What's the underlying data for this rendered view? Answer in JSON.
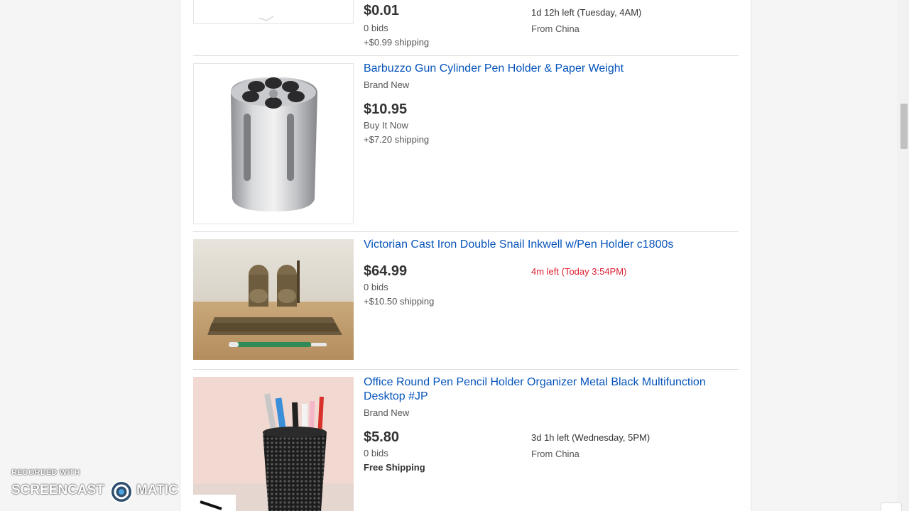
{
  "items": [
    {
      "title": "",
      "price": "$0.01",
      "format": "0 bids",
      "shipping": "+$0.99 shipping",
      "time_left": "1d 12h left (Tuesday, 4AM)",
      "location": "From China"
    },
    {
      "title": "Barbuzzo Gun Cylinder Pen Holder & Paper Weight",
      "condition": "Brand New",
      "price": "$10.95",
      "format": "Buy It Now",
      "shipping": "+$7.20 shipping"
    },
    {
      "title": "Victorian Cast Iron Double Snail Inkwell w/Pen Holder c1800s",
      "price": "$64.99",
      "format": "0 bids",
      "shipping": "+$10.50 shipping",
      "time_left": "4m left (Today 3:54PM)"
    },
    {
      "title": "Office Round Pen Pencil Holder Organizer Metal Black Multifunction Desktop #JP",
      "condition": "Brand New",
      "price": "$5.80",
      "format": "0 bids",
      "shipping": "Free Shipping",
      "time_left": "3d 1h left (Wednesday, 5PM)",
      "location": "From China"
    }
  ],
  "watermark": {
    "line1": "RECORDED WITH",
    "left": "SCREENCAST",
    "right": "MATIC"
  },
  "colors": {
    "link": "#0654ba",
    "urgent": "#dd1e31",
    "price": "#333333"
  }
}
